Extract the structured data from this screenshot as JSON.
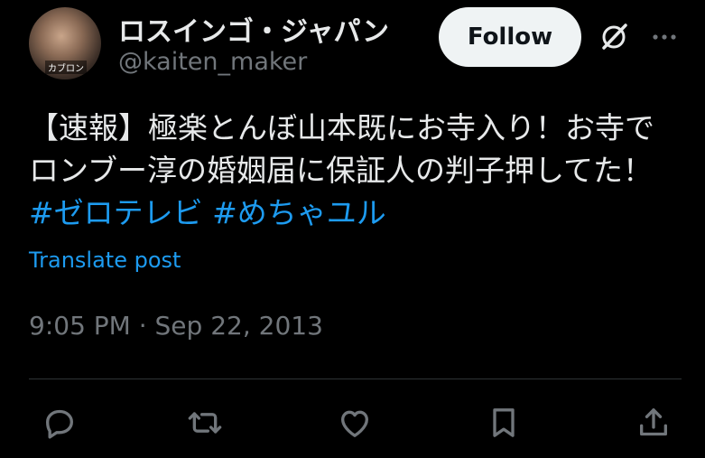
{
  "author": {
    "display_name": "ロスインゴ・ジャパン",
    "handle": "@kaiten_maker",
    "avatar_caption": "カブロン"
  },
  "header": {
    "follow_label": "Follow",
    "grok_icon": "grok-icon",
    "more_icon": "more-icon"
  },
  "tweet": {
    "line1": "【速報】極楽とんぼ山本既にお寺入り！お寺で",
    "line2": "ロンブー淳の婚姻届に保証人の判子押してた！",
    "hashtag1": "#ゼロテレビ",
    "hashtag2": "#めちゃユル",
    "translate_label": "Translate post",
    "timestamp": "9:05 PM · Sep 22, 2013"
  },
  "actions": {
    "reply_icon": "reply-icon",
    "repost_icon": "repost-icon",
    "like_icon": "like-icon",
    "bookmark_icon": "bookmark-icon",
    "share_icon": "share-icon"
  },
  "colors": {
    "background": "#000000",
    "primary_text": "#e7e9ea",
    "secondary_text": "#71767b",
    "link": "#1d9bf0",
    "follow_bg": "#eff3f4",
    "divider": "#2f3336"
  }
}
